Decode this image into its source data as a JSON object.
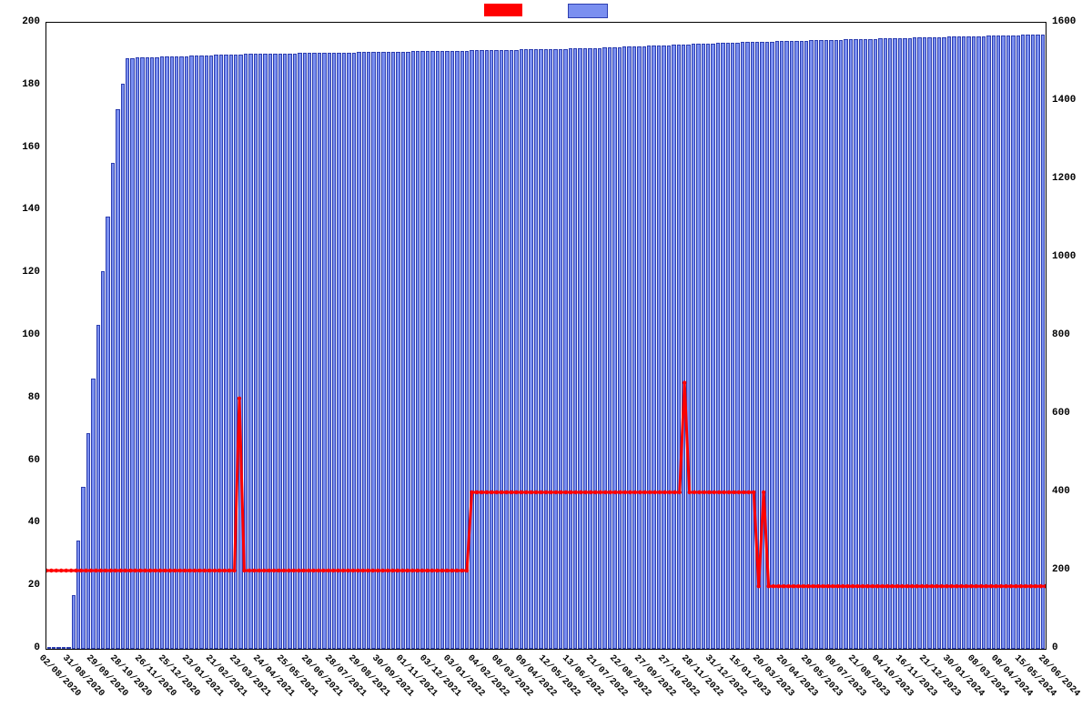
{
  "chart_data": {
    "type": "combo-bar-line",
    "legend": {
      "series1_color": "#ff0000",
      "series2_color": "#7a8ff0"
    },
    "left_axis": {
      "min": 0,
      "max": 200,
      "step": 20,
      "ticks": [
        0,
        20,
        40,
        60,
        80,
        100,
        120,
        140,
        160,
        180,
        200
      ]
    },
    "right_axis": {
      "min": 0,
      "max": 1600,
      "step": 200,
      "ticks": [
        0,
        200,
        400,
        600,
        800,
        1000,
        1200,
        1400,
        1600
      ]
    },
    "x_labels_visible": [
      "02/08/2020",
      "31/08/2020",
      "29/09/2020",
      "28/10/2020",
      "26/11/2020",
      "25/12/2020",
      "23/01/2021",
      "21/02/2021",
      "23/03/2021",
      "24/04/2021",
      "25/05/2021",
      "28/06/2021",
      "28/07/2021",
      "29/08/2021",
      "30/09/2021",
      "01/11/2021",
      "03/12/2021",
      "03/01/2022",
      "04/02/2022",
      "08/03/2022",
      "09/04/2022",
      "12/05/2022",
      "13/06/2022",
      "21/07/2022",
      "22/08/2022",
      "27/09/2022",
      "27/10/2022",
      "28/11/2022",
      "31/12/2022",
      "15/01/2023",
      "20/03/2023",
      "20/04/2023",
      "29/05/2023",
      "08/07/2023",
      "21/08/2023",
      "04/10/2023",
      "16/11/2023",
      "21/12/2023",
      "30/01/2024",
      "08/03/2024",
      "08/04/2024",
      "15/05/2024",
      "28/06/2024"
    ],
    "series_bars_right_axis": {
      "note": "Approximate bar heights (right axis, 0-1600). ~203 bars weekly from 02/08/2020 to 28/06/2024.",
      "values_sampled": "interpolated below in JS for rendering",
      "anchors": [
        {
          "idx": 0,
          "val": 0
        },
        {
          "idx": 3,
          "val": 0
        },
        {
          "idx": 4,
          "val": 0
        },
        {
          "idx": 14,
          "val": 1380
        },
        {
          "idx": 16,
          "val": 1510
        },
        {
          "idx": 40,
          "val": 1520
        },
        {
          "idx": 90,
          "val": 1530
        },
        {
          "idx": 110,
          "val": 1535
        },
        {
          "idx": 140,
          "val": 1550
        },
        {
          "idx": 170,
          "val": 1560
        },
        {
          "idx": 202,
          "val": 1570
        }
      ],
      "count": 203
    },
    "series_line_left_axis": {
      "note": "Red line points (left axis 0-200). Index = weekly step.",
      "anchors": [
        {
          "idx": 0,
          "val": 25
        },
        {
          "idx": 38,
          "val": 25
        },
        {
          "idx": 39,
          "val": 80
        },
        {
          "idx": 40,
          "val": 25
        },
        {
          "idx": 85,
          "val": 25
        },
        {
          "idx": 86,
          "val": 50
        },
        {
          "idx": 128,
          "val": 50
        },
        {
          "idx": 129,
          "val": 85
        },
        {
          "idx": 130,
          "val": 50
        },
        {
          "idx": 143,
          "val": 50
        },
        {
          "idx": 144,
          "val": 20
        },
        {
          "idx": 145,
          "val": 50
        },
        {
          "idx": 146,
          "val": 20
        },
        {
          "idx": 202,
          "val": 20
        }
      ],
      "count": 203
    }
  }
}
